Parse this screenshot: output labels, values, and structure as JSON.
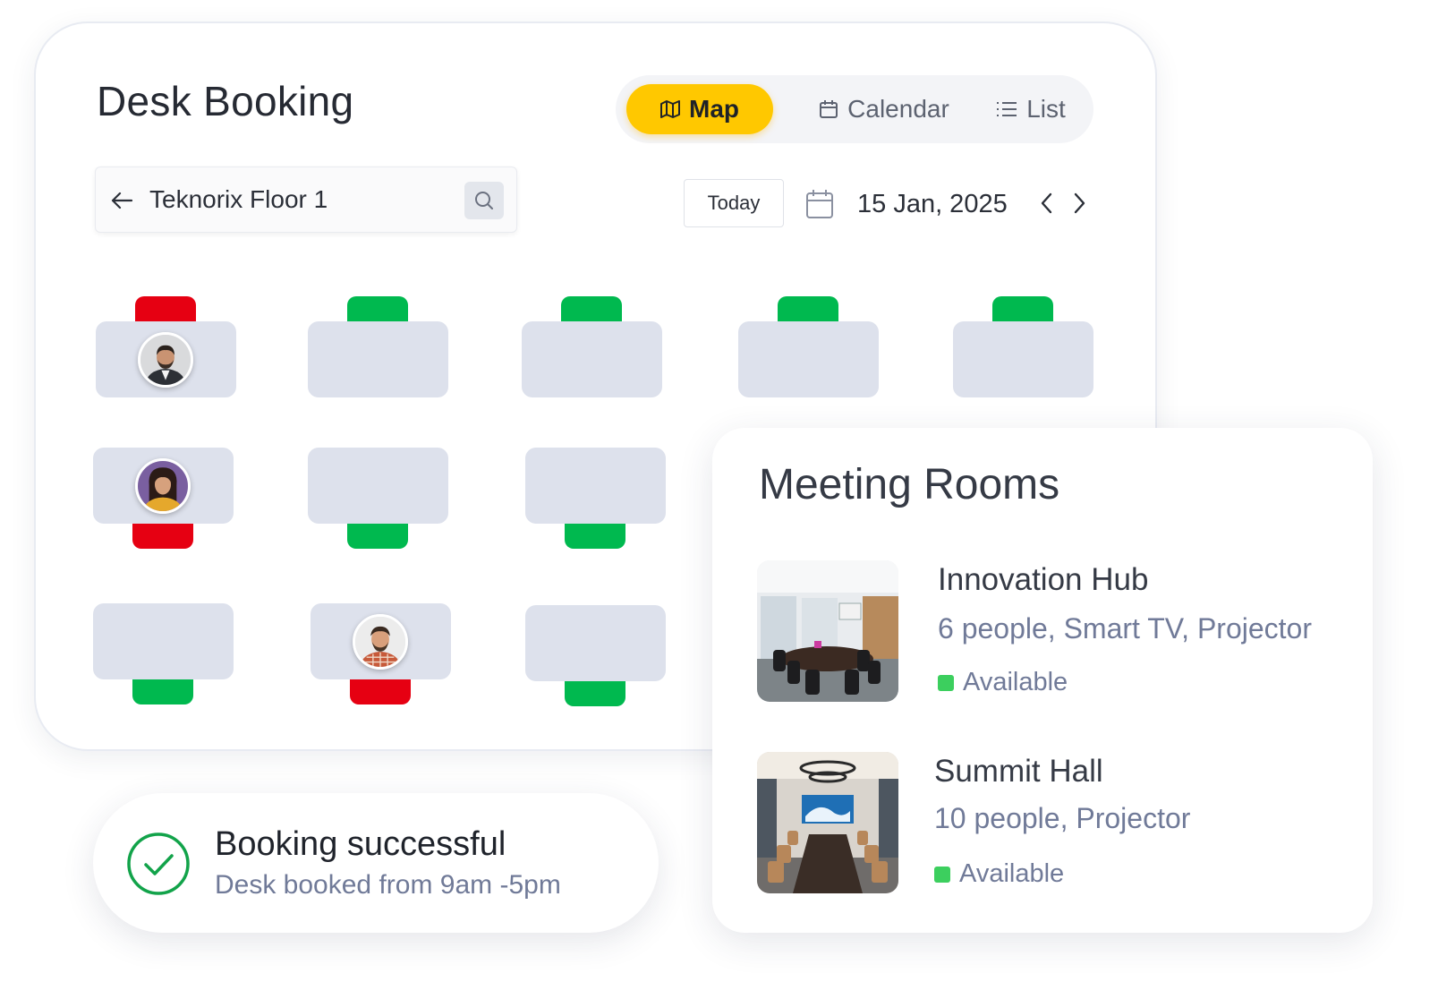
{
  "header": {
    "title": "Desk Booking"
  },
  "views": {
    "map_label": "Map",
    "calendar_label": "Calendar",
    "list_label": "List",
    "active": "Map",
    "accent": "#ffc800"
  },
  "search": {
    "value": "Teknorix Floor 1"
  },
  "date_nav": {
    "today_label": "Today",
    "date": "15 Jan, 2025"
  },
  "status_colors": {
    "booked": "#e60012",
    "available": "#00b94f"
  },
  "desks": [
    {
      "status": "booked",
      "occupant": "man-suit-avatar"
    },
    {
      "status": "available"
    },
    {
      "status": "available"
    },
    {
      "status": "available"
    },
    {
      "status": "available"
    },
    {
      "status": "booked",
      "occupant": "woman-avatar"
    },
    {
      "status": "available"
    },
    {
      "status": "available"
    },
    {
      "status": "available"
    },
    {
      "status": "booked",
      "occupant": "man-plaid-avatar"
    },
    {
      "status": "available"
    }
  ],
  "rooms": {
    "title": "Meeting Rooms",
    "items": [
      {
        "name": "Innovation Hub",
        "info": "6 people, Smart TV, Projector",
        "status": "Available"
      },
      {
        "name": "Summit Hall",
        "info": "10 people, Projector",
        "status": "Available"
      }
    ]
  },
  "toast": {
    "title": "Booking successful",
    "subtitle": "Desk booked from 9am -5pm"
  }
}
